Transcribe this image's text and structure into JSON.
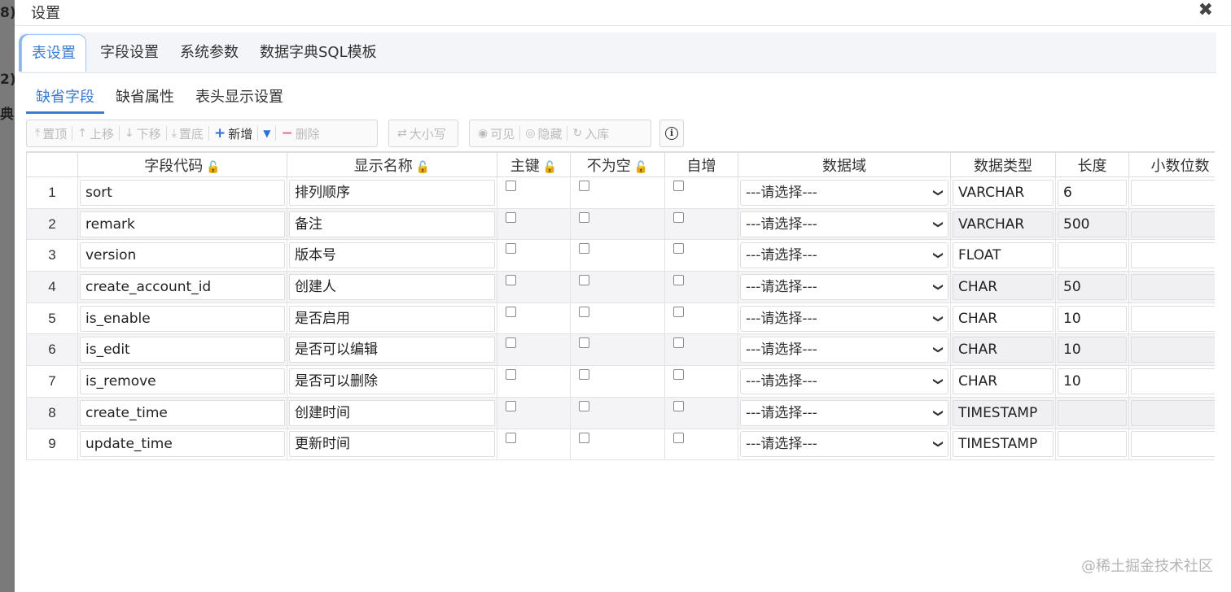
{
  "background": {
    "fragments": [
      "8)",
      "2)",
      "典("
    ]
  },
  "dialog": {
    "title": "设置",
    "close": "✖"
  },
  "tabs_main": [
    "表设置",
    "字段设置",
    "系统参数",
    "数据字典SQL模板"
  ],
  "tabs_sub": [
    "缺省字段",
    "缺省属性",
    "表头显示设置"
  ],
  "toolbar": {
    "top": "置顶",
    "up": "上移",
    "down": "下移",
    "bottom": "置底",
    "add": "新增",
    "delete": "删除",
    "case": "大小写",
    "visible": "可见",
    "hide": "隐藏",
    "import": "入库"
  },
  "columns": [
    "字段代码",
    "显示名称",
    "主键",
    "不为空",
    "自增",
    "数据域",
    "数据类型",
    "长度",
    "小数位数"
  ],
  "select_placeholder": "---请选择---",
  "rows": [
    {
      "n": "1",
      "code": "sort",
      "name": "排列顺序",
      "type": "VARCHAR",
      "len": "6"
    },
    {
      "n": "2",
      "code": "remark",
      "name": "备注",
      "type": "VARCHAR",
      "len": "500"
    },
    {
      "n": "3",
      "code": "version",
      "name": "版本号",
      "type": "FLOAT",
      "len": ""
    },
    {
      "n": "4",
      "code": "create_account_id",
      "name": "创建人",
      "type": "CHAR",
      "len": "50"
    },
    {
      "n": "5",
      "code": "is_enable",
      "name": "是否启用",
      "type": "CHAR",
      "len": "10"
    },
    {
      "n": "6",
      "code": "is_edit",
      "name": "是否可以编辑",
      "type": "CHAR",
      "len": "10"
    },
    {
      "n": "7",
      "code": "is_remove",
      "name": "是否可以删除",
      "type": "CHAR",
      "len": "10"
    },
    {
      "n": "8",
      "code": "create_time",
      "name": "创建时间",
      "type": "TIMESTAMP",
      "len": ""
    },
    {
      "n": "9",
      "code": "update_time",
      "name": "更新时间",
      "type": "TIMESTAMP",
      "len": ""
    }
  ],
  "watermark": "@稀土掘金技术社区",
  "colors": {
    "accent": "#3a7bd5"
  }
}
